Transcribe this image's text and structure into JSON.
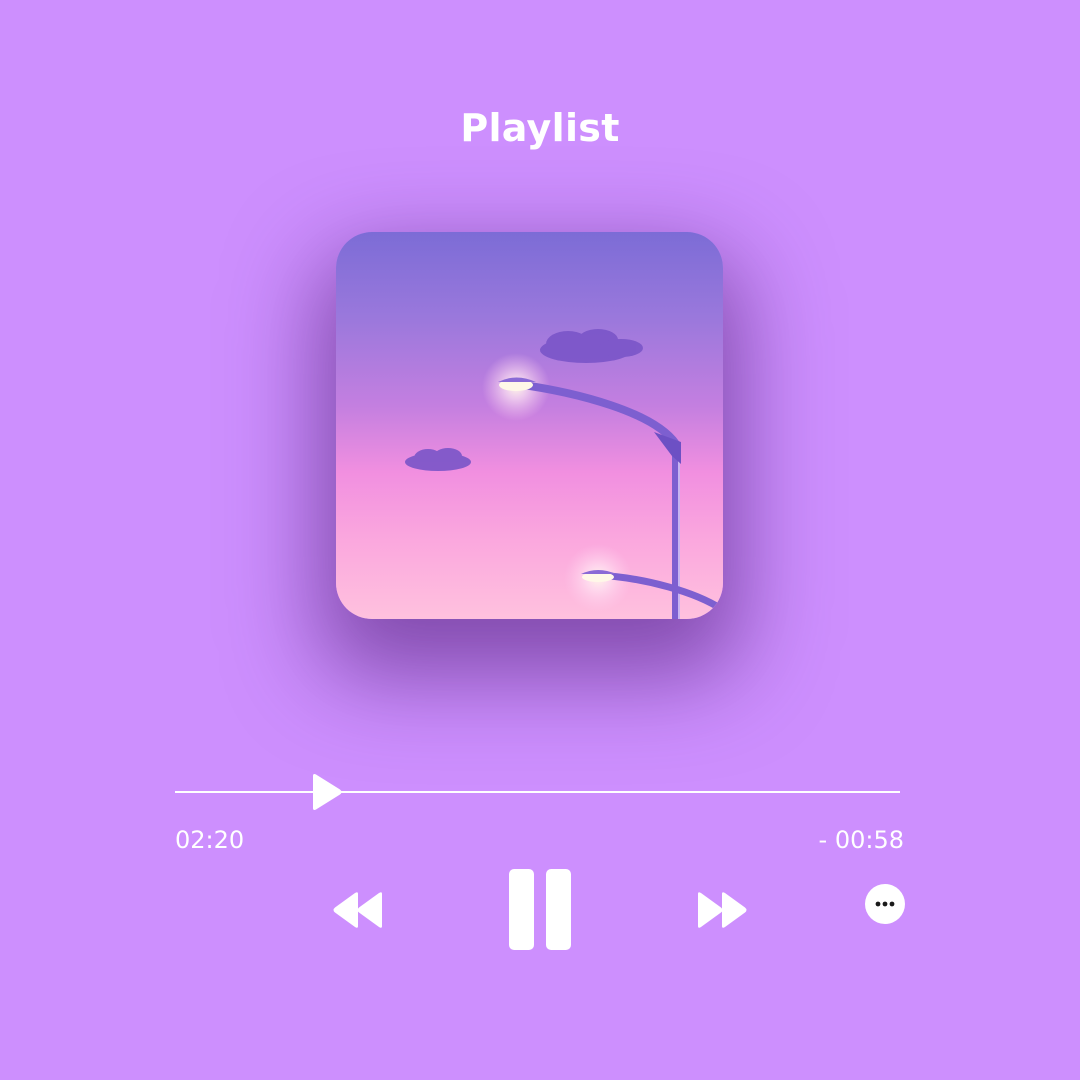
{
  "header": {
    "title": "Playlist"
  },
  "album_art": {
    "icon": "album-art-image",
    "description_colors": {
      "sky_top": "#7c6cd6",
      "sky_bottom": "#ffc1de"
    }
  },
  "player": {
    "progress_fraction": 0.19,
    "elapsed": "02:20",
    "remaining": "- 00:58",
    "controls": {
      "rewind_icon": "rewind-icon",
      "pause_icon": "pause-icon",
      "forward_icon": "fast-forward-icon",
      "more_icon": "more-options-icon"
    }
  },
  "colors": {
    "background": "#cd8ffe",
    "foreground": "#ffffff"
  }
}
